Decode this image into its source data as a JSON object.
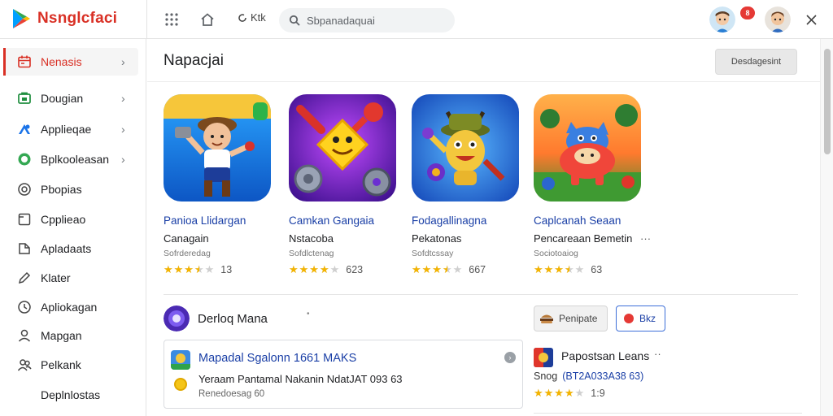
{
  "app": {
    "title": "Nsnglcfaci",
    "colors": {
      "accent": "#d93025",
      "link": "#1a3fa6",
      "star": "#f4b400"
    }
  },
  "topbar": {
    "grid_icon": "apps-grid-icon",
    "home_icon": "home-icon",
    "sync_label": "Ktk",
    "search_placeholder": "Sbpanadaquai",
    "notification_count": "8"
  },
  "sidebar": {
    "items": [
      {
        "label": "Nenasis",
        "icon": "calendar-icon",
        "active": true,
        "chevron": true
      },
      {
        "label": "Dougian",
        "icon": "briefcase-icon",
        "chevron": true
      },
      {
        "label": "Applieqae",
        "icon": "puzzle-icon",
        "chevron": true
      },
      {
        "label": "Bplkooleasan",
        "icon": "android-icon",
        "chevron": true
      },
      {
        "label": "Pbopias",
        "icon": "settings-circle-icon"
      },
      {
        "label": "Cpplieao",
        "icon": "square-icon"
      },
      {
        "label": "Apladaats",
        "icon": "folder-icon"
      },
      {
        "label": "Klater",
        "icon": "pencil-icon"
      },
      {
        "label": "Apliokagan",
        "icon": "lock-icon"
      },
      {
        "label": "Mapgan",
        "icon": "person-icon"
      },
      {
        "label": "Pelkank",
        "icon": "people-icon"
      },
      {
        "label": "Deplnlostas",
        "icon": ""
      }
    ]
  },
  "main": {
    "section_title": "Napacjai",
    "header_button": "Desdagesint",
    "apps": [
      {
        "title": "Panioa Llidargan",
        "developer": "Canagain",
        "category": "Sofrderedag",
        "rating": 3.5,
        "rating_count": "13"
      },
      {
        "title": "Camkan Gangaia",
        "developer": "Nstacoba",
        "category": "Sofdlctenag",
        "rating": 4,
        "rating_count": "623"
      },
      {
        "title": "Fodagallinagna",
        "developer": "Pekatonas",
        "category": "Sofdtcssay",
        "rating": 3.5,
        "rating_count": "667"
      },
      {
        "title": "Caplcanah Seaan",
        "developer": "Pencareaan Bemetin",
        "category": "Sociotoaiog",
        "rating": 3.5,
        "rating_count": "63",
        "more": "···"
      }
    ],
    "developer_section": {
      "name": "Derloq Mana",
      "dot": "•",
      "chip_gray": "Penipate",
      "chip_blue": "Bkz"
    },
    "list_card": {
      "title": "Mapadal Sgalonn 1661 MAKS",
      "line2": "Yeraam Pantamal Nakanin NdatJAT 093 63",
      "line3": "Renedoesag 60"
    },
    "side_item": {
      "title": "Papostsan Leans",
      "more": "··",
      "line2_prefix": "Snog",
      "line2_value": "(BT2A033A38 63)",
      "rating": 4,
      "rating_count": "1:9"
    }
  }
}
